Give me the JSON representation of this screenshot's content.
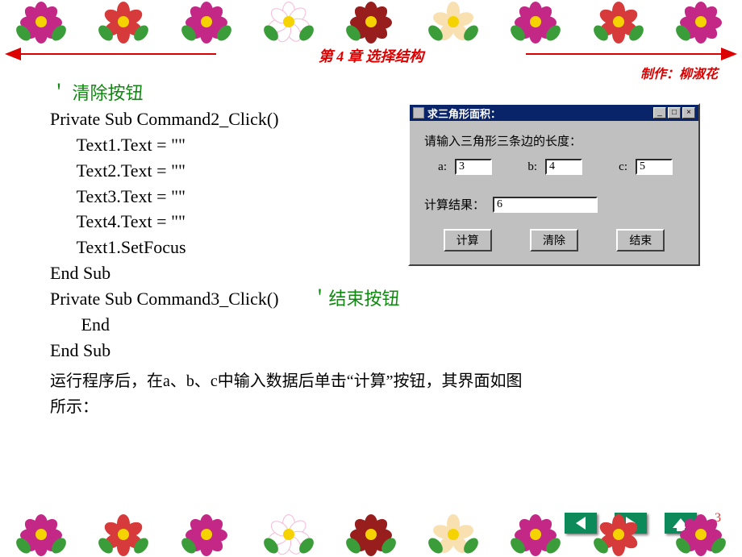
{
  "chapter_title": "第 4 章   选择结构",
  "credit": "制作：柳淑花",
  "comment_clear": "＇ 清除按钮",
  "comment_end": "＇结束按钮",
  "code_block1": "Private Sub Command2_Click()\n      Text1.Text = \"\"\n      Text2.Text = \"\"\n      Text3.Text = \"\"\n      Text4.Text = \"\"\n      Text1.SetFocus\nEnd Sub",
  "code_block2_line1": "Private Sub Command3_Click()",
  "code_block2_rest": "       End\nEnd Sub",
  "description": "运行程序后，在a、b、c中输入数据后单击“计算”按钮，其界面如图\n        所示：",
  "page_number": "3",
  "dialog": {
    "title": "求三角形面积：",
    "prompt": "请输入三角形三条边的长度：",
    "a_label": "a:",
    "b_label": "b:",
    "c_label": "c:",
    "a_value": "3",
    "b_value": "4",
    "c_value": "5",
    "result_label": "计算结果：",
    "result_value": "6",
    "btn_calc": "计算",
    "btn_clear": "清除",
    "btn_end": "结束"
  },
  "nav": {
    "prev": "prev",
    "next": "next",
    "home": "home"
  }
}
